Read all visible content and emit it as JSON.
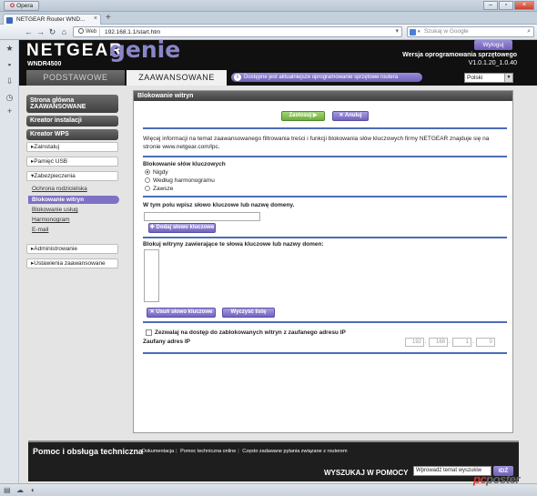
{
  "browser": {
    "menu_label": "Opera",
    "tab_title": "NETGEAR Router WND...",
    "new_tab": "+",
    "address_mode": "Web",
    "url": "192.168.1.1/start.htm",
    "search_placeholder": "Szukaj w Google",
    "watermark_left": "pc",
    "watermark_right": "poster"
  },
  "router": {
    "logo": "NETGEAR",
    "genie": "genie",
    "model": "WNDR4500",
    "logout": "Wyloguj",
    "firmware_label": "Wersja oprogramowania sprzętowego",
    "firmware_version": "V1.0.1.20_1.0.40",
    "tab_basic": "PODSTAWOWE",
    "tab_advanced": "ZAAWANSOWANE",
    "update_note": "Dostępne jest aktualniejsze oprogramowanie sprzętowe routera",
    "language": "Polski"
  },
  "menu": {
    "home": "Strona główna ZAAWANSOWANE",
    "setup_wizard": "Kreator instalacji",
    "wps_wizard": "Kreator WPS",
    "setup": "Zainstaluj",
    "usb": "Pamięć USB",
    "security": "Zabezpieczenia",
    "security_items": [
      "Ochrona rodzicielska",
      "Blokowanie witryn",
      "Blokowanie usług",
      "Harmonogram",
      "E-mail"
    ],
    "admin": "Administrowanie",
    "advanced_settings": "Ustawienia zaawansowane"
  },
  "panel": {
    "title": "Blokowanie witryn",
    "apply": "Zastosuj",
    "cancel": "Anuluj",
    "info_line1": "Więcej informacji na temat zaawansowanego filtrowania treści i funkcji blokowania słów kluczowych firmy NETGEAR znajduje się na",
    "info_line2": "stronie www.netgear.com/lpc.",
    "keyword_heading": "Blokowanie słów kluczowych",
    "radio_never": "Nigdy",
    "radio_schedule": "Według harmonogramu",
    "radio_always": "Zawsze",
    "radio_selected": "never",
    "input_label": "W tym polu wpisz słowo kluczowe lub nazwę domeny.",
    "add_keyword": "Dodaj słowo kluczowe",
    "block_list_label": "Blokuj witryny zawierające te słowa kluczowe lub nazwy domen:",
    "delete_keyword": "Usuń słowo kluczowe",
    "clear_list": "Wyczyść listę",
    "trusted_checkbox_label": "Zezwalaj na dostęp do zablokowanych witryn z zaufanego adresu IP",
    "trusted_ip_label": "Zaufany adres IP",
    "ip_octets": [
      "192",
      "168",
      "1",
      "0"
    ]
  },
  "footer": {
    "title": "Pomoc i obsługa techniczna",
    "link_docs": "Dokumentacja",
    "link_support": "Pomoc techniczna online",
    "link_faq": "Często zadawane pytania związane z routerem",
    "search_label": "WYSZUKAJ W POMOCY",
    "search_value": "Wprowadź temat wyszukiw",
    "go": "IDŹ"
  }
}
